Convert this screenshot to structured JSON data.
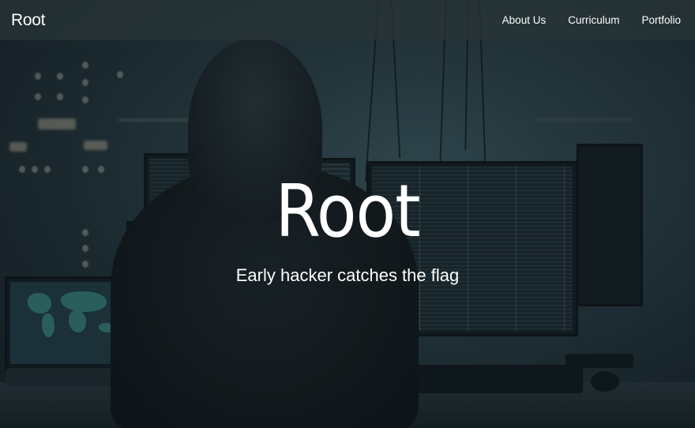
{
  "navbar": {
    "brand": "Root",
    "links": [
      {
        "label": "About Us"
      },
      {
        "label": "Curriculum"
      },
      {
        "label": "Portfolio"
      }
    ]
  },
  "hero": {
    "title": "Root",
    "subtitle": "Early hacker catches the flag"
  },
  "colors": {
    "text": "#ffffff",
    "navbar_bg": "#283438",
    "scene_accent": "#3a8f86"
  }
}
